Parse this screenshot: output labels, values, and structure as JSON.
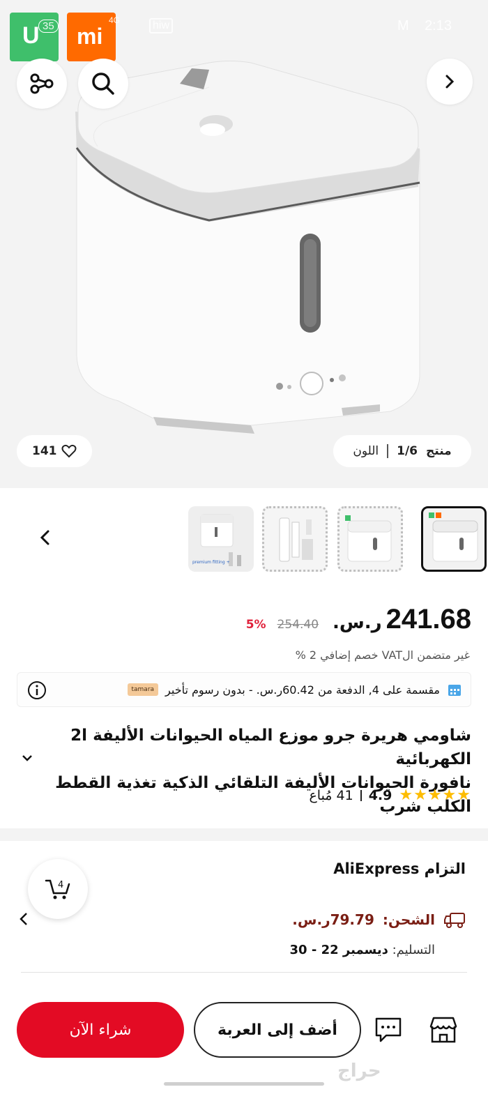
{
  "status_bar": {
    "network": "35",
    "signal": "4G",
    "carrier_logo": "hiw",
    "battery": "M",
    "time": "2:13"
  },
  "app_badges": {
    "mi_home": "U",
    "mi": "mi"
  },
  "hero": {
    "likes": "141",
    "color_label": "اللون",
    "product_counter": "1/6",
    "product_word": "منتج"
  },
  "thumbnails": [
    {
      "label": "thumb-1",
      "state": "active"
    },
    {
      "label": "thumb-2",
      "state": "dashed"
    },
    {
      "label": "thumb-3",
      "state": "dashed"
    },
    {
      "label": "thumb-4",
      "state": "normal",
      "caption": "premium fitting +"
    }
  ],
  "price": {
    "current": "241.68",
    "currency": "ر.س.",
    "original": "254.40",
    "discount": "5%"
  },
  "vat_line": "غير متضمن الVAT خصم إضافي 2 %",
  "installments": {
    "text": "مقسمة على 4, الدفعة من 60.42ر.س. - بدون رسوم تأخير",
    "provider": "tamara"
  },
  "product": {
    "title_line1": "شاومي هريرة جرو موزع المياه الحيوانات الأليفة 2l الكهربائية",
    "title_line2": "نافورة الحيوانات الأليفة التلقائي الذكية تغذية القطط الكلب شرب"
  },
  "rating": {
    "stars": "★★★★★",
    "score": "4.9",
    "sold": "41 مُباع"
  },
  "commitment": {
    "title": "التزام AliExpress",
    "shipping_label": "الشحن:",
    "shipping_value": "79.79ر.س.",
    "delivery_label": "التسليم:",
    "delivery_date": "ديسمبر 22 - 30"
  },
  "cart_badge": "4",
  "actions": {
    "buy_now": "شراء الآن",
    "add_to_cart": "أضف إلى العربة"
  },
  "watermark": "حراج",
  "colors": {
    "accent": "#e30b24",
    "star": "#fdbc00",
    "shipping": "#7a1e14"
  },
  "icons": [
    "share-icon",
    "search-icon",
    "chevron-right-icon",
    "heart-icon",
    "chevron-left-icon",
    "info-icon",
    "calendar-icon",
    "truck-icon",
    "cart-icon",
    "chat-icon",
    "store-icon"
  ]
}
